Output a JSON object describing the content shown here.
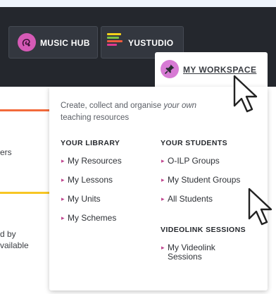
{
  "nav": {
    "tabs": [
      {
        "label": "MUSIC HUB",
        "icon": "music-hub-icon"
      },
      {
        "label": "YUSTUDIO",
        "icon": "yustudio-icon"
      }
    ],
    "workspace": {
      "label": "MY WORKSPACE",
      "icon": "pin-icon"
    }
  },
  "background": {
    "fragment_1": "ers",
    "fragment_2": "d by",
    "fragment_3": "vailable"
  },
  "dropdown": {
    "intro_part1": "Create, collect and organise ",
    "intro_italic": "your own",
    "intro_part2": "teaching resources",
    "library": {
      "heading": "YOUR LIBRARY",
      "items": [
        "My Resources",
        "My Lessons",
        "My Units",
        "My Schemes"
      ]
    },
    "students": {
      "heading": "YOUR STUDENTS",
      "items": [
        "O-ILP Groups",
        "My Student Groups",
        "All Students"
      ]
    },
    "videolink": {
      "heading": "VIDEOLINK SESSIONS",
      "item_line1": "My Videolink",
      "item_line2": "Sessions"
    }
  },
  "colors": {
    "navbar": "#24272d",
    "music_accent": "#d65ab6",
    "pin_accent": "#d77ad4",
    "link_arrow": "#c0458f",
    "orange_rule": "#f26a3b",
    "yellow_rule": "#f7c624"
  }
}
